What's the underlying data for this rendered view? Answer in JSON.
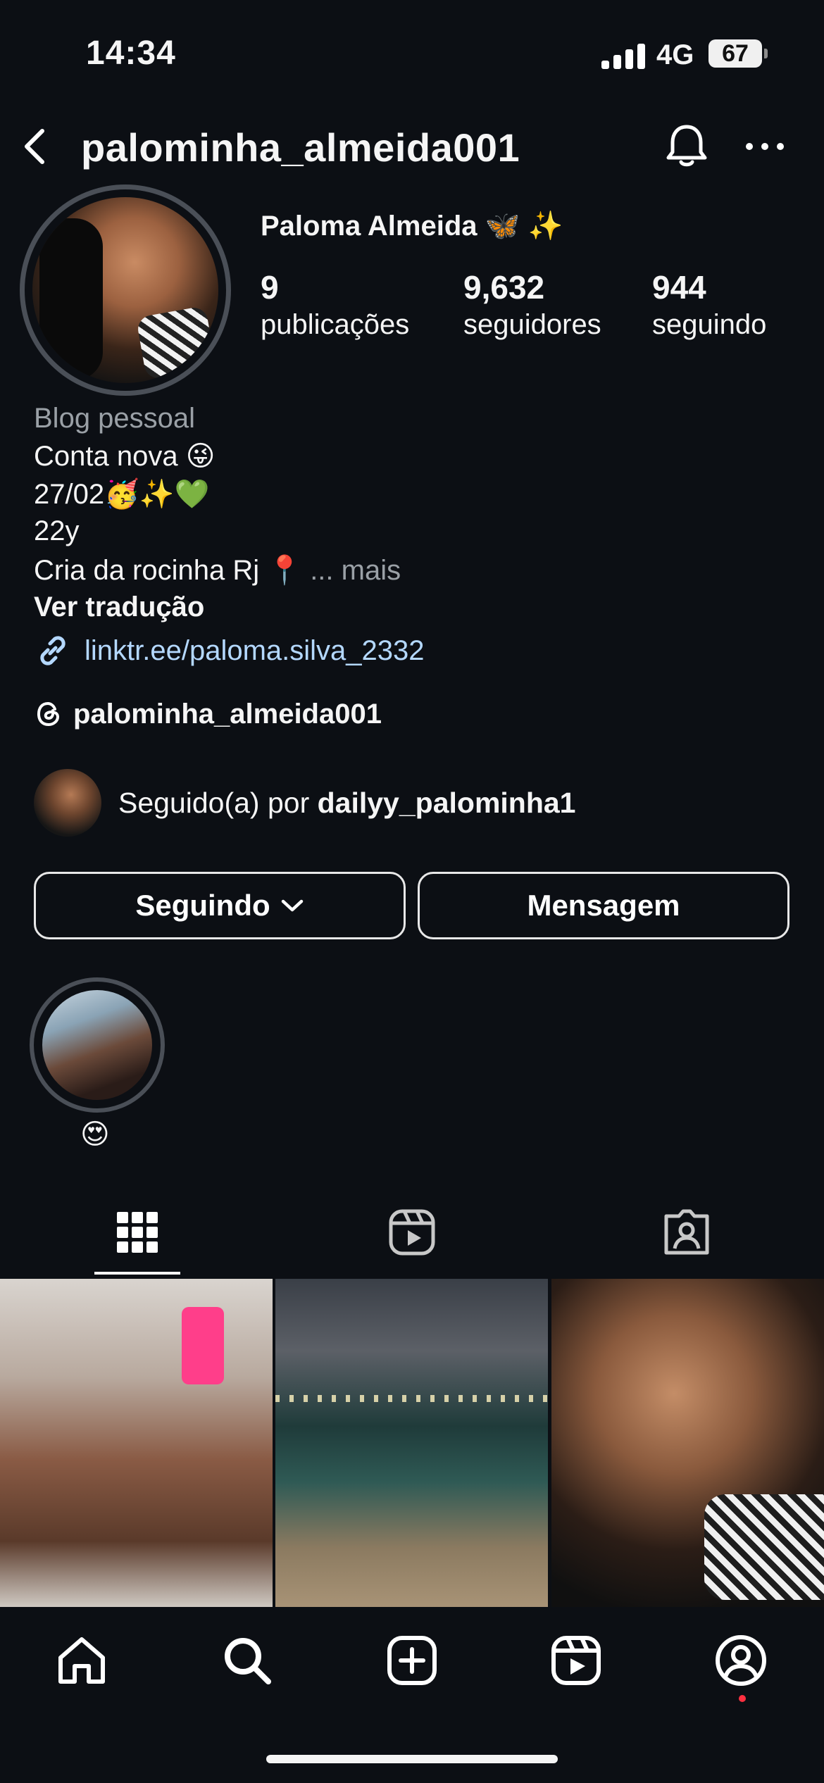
{
  "status_bar": {
    "time": "14:34",
    "network": "4G",
    "battery": "67"
  },
  "header": {
    "username": "palominha_almeida001"
  },
  "profile": {
    "display_name": "Paloma Almeida 🦋 ✨",
    "stats": [
      {
        "value": "9",
        "label": "publicações"
      },
      {
        "value": "9,632",
        "label": "seguidores"
      },
      {
        "value": "944",
        "label": "seguindo"
      }
    ]
  },
  "bio": {
    "category": "Blog pessoal",
    "lines": [
      "Conta nova 😜",
      "27/02🥳✨💚",
      "22y",
      "Cria da rocinha Rj 📍"
    ],
    "more": "... mais",
    "translate": "Ver tradução",
    "link": "linktr.ee/paloma.silva_2332"
  },
  "threads": {
    "handle": "palominha_almeida001"
  },
  "followed_by": {
    "prefix": "Seguido(a) por ",
    "user": "dailyy_palominha1"
  },
  "actions": {
    "following": "Seguindo",
    "message": "Mensagem"
  },
  "highlight": {
    "label": "😍"
  },
  "tabs": [
    "grid-icon",
    "reels-icon",
    "tagged-icon"
  ],
  "bottom_nav": [
    "home-icon",
    "search-icon",
    "create-icon",
    "reels-icon",
    "profile-icon"
  ]
}
